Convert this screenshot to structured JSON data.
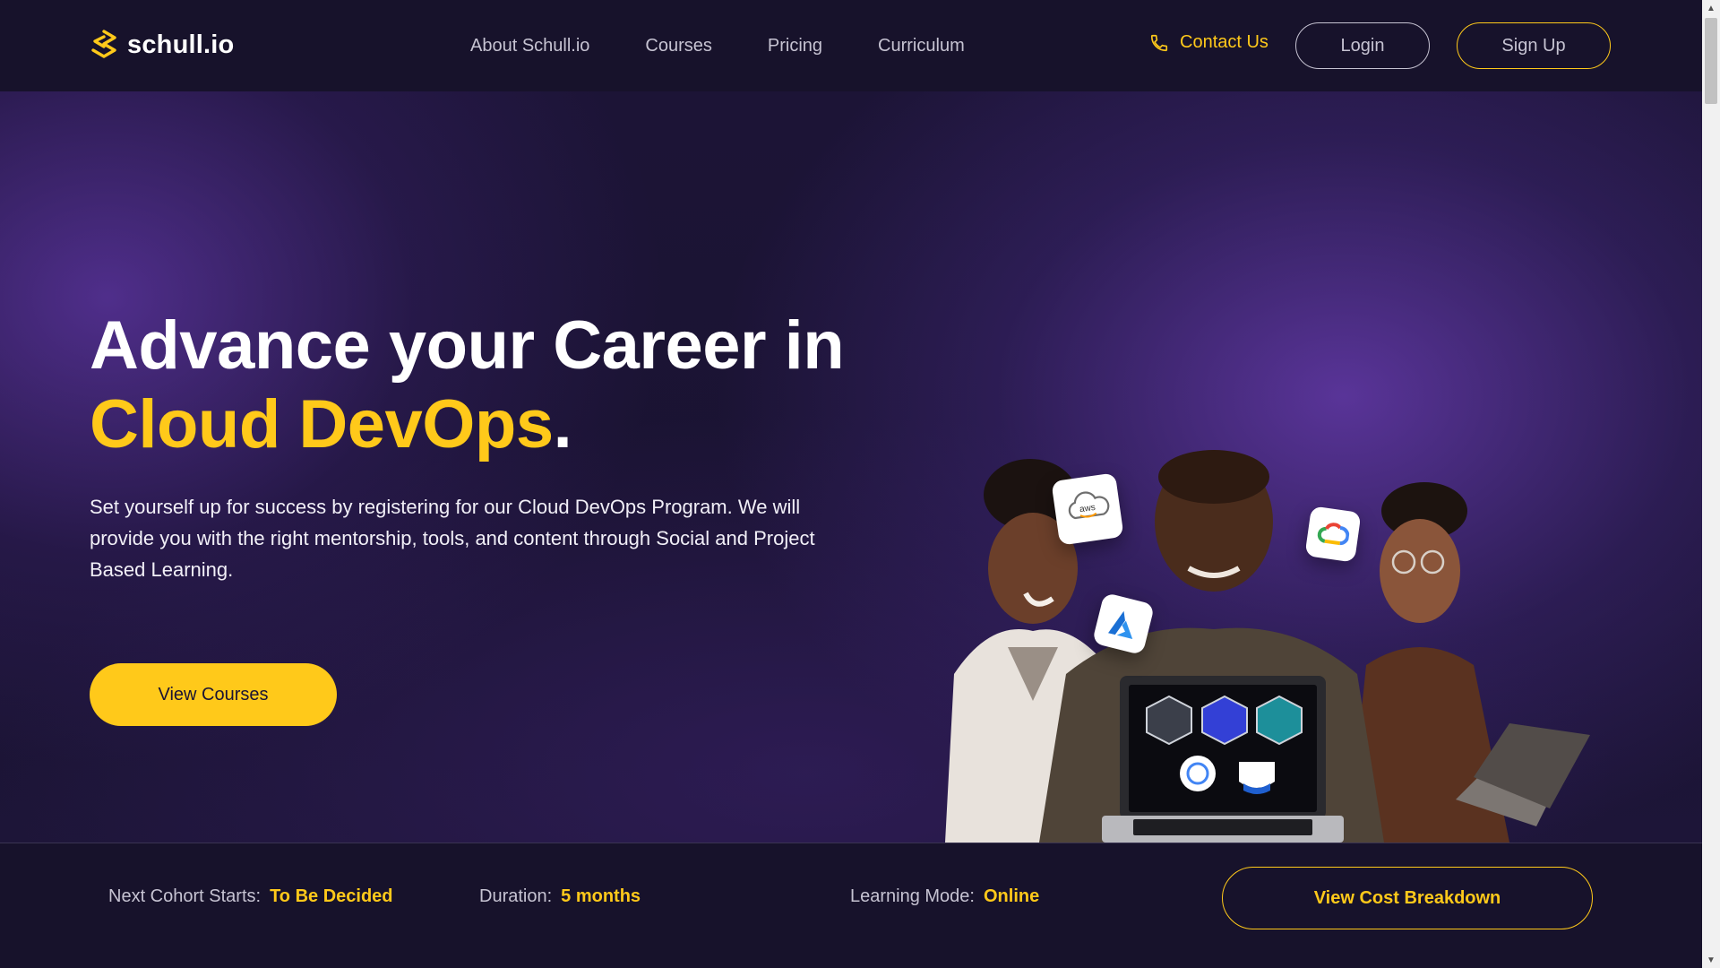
{
  "brand": {
    "name": "schull.io",
    "logo_icon": "schull-logo-icon",
    "accent": "#ffc91a"
  },
  "nav": {
    "links": [
      {
        "label": "About Schull.io"
      },
      {
        "label": "Courses"
      },
      {
        "label": "Pricing"
      },
      {
        "label": "Curriculum"
      }
    ],
    "contact_label": "Contact Us",
    "contact_icon": "phone-icon",
    "login_label": "Login",
    "signup_label": "Sign Up"
  },
  "hero": {
    "title_line1": "Advance your Career in",
    "title_accent": "Cloud DevOps",
    "title_dot": ".",
    "description": "Set yourself up for success by registering for our Cloud DevOps Program. We will provide you with the right mentorship, tools, and content through Social and Project Based Learning.",
    "cta_label": "View Courses",
    "badges": [
      "aws-icon",
      "azure-icon",
      "google-cloud-icon"
    ],
    "aws_text": "aws"
  },
  "info": {
    "cohort_label": "Next Cohort Starts:",
    "cohort_value": "To Be Decided",
    "duration_label": "Duration:",
    "duration_value": "5 months",
    "mode_label": "Learning Mode:",
    "mode_value": "Online",
    "cost_button": "View Cost Breakdown"
  }
}
